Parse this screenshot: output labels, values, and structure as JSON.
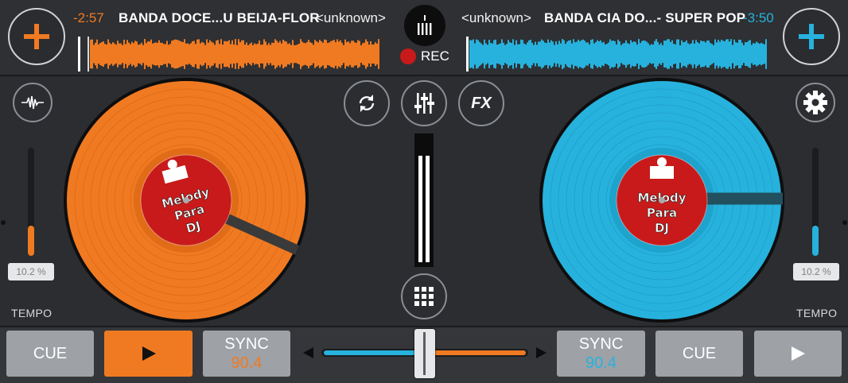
{
  "colors": {
    "deck_a": "#f07a22",
    "deck_b": "#27b2dd",
    "rec": "#c81a1a",
    "pad": "#9ea1a6"
  },
  "deck_a": {
    "time": "-2:57",
    "title": "BANDA DOCE...U BEIJA-FLOR",
    "artist": "<unknown>",
    "tempo": "10.2 %",
    "tempo_label": "TEMPO",
    "cue_label": "CUE",
    "play_icon": "play-icon",
    "sync_label": "SYNC",
    "bpm": "90.4",
    "label_text": [
      "Melody",
      "Para",
      "DJ"
    ],
    "tempo_level": 0.28
  },
  "deck_b": {
    "time": "-3:50",
    "title": "BANDA CIA DO...- SUPER POP",
    "artist": "<unknown>",
    "tempo": "10.2 %",
    "tempo_label": "TEMPO",
    "cue_label": "CUE",
    "play_icon": "play-icon",
    "sync_label": "SYNC",
    "bpm": "90.4",
    "label_text": [
      "Melody",
      "Para",
      "DJ"
    ],
    "tempo_level": 0.28
  },
  "center": {
    "rec_label": "REC",
    "fx_label": "FX",
    "crossfader_position": 0.5
  },
  "icons": [
    "add-icon",
    "waveform-icon",
    "sync-loop-icon",
    "mixer-icon",
    "fx-icon",
    "settings-icon",
    "grid-icon",
    "record-icon",
    "vinyl-icon"
  ]
}
